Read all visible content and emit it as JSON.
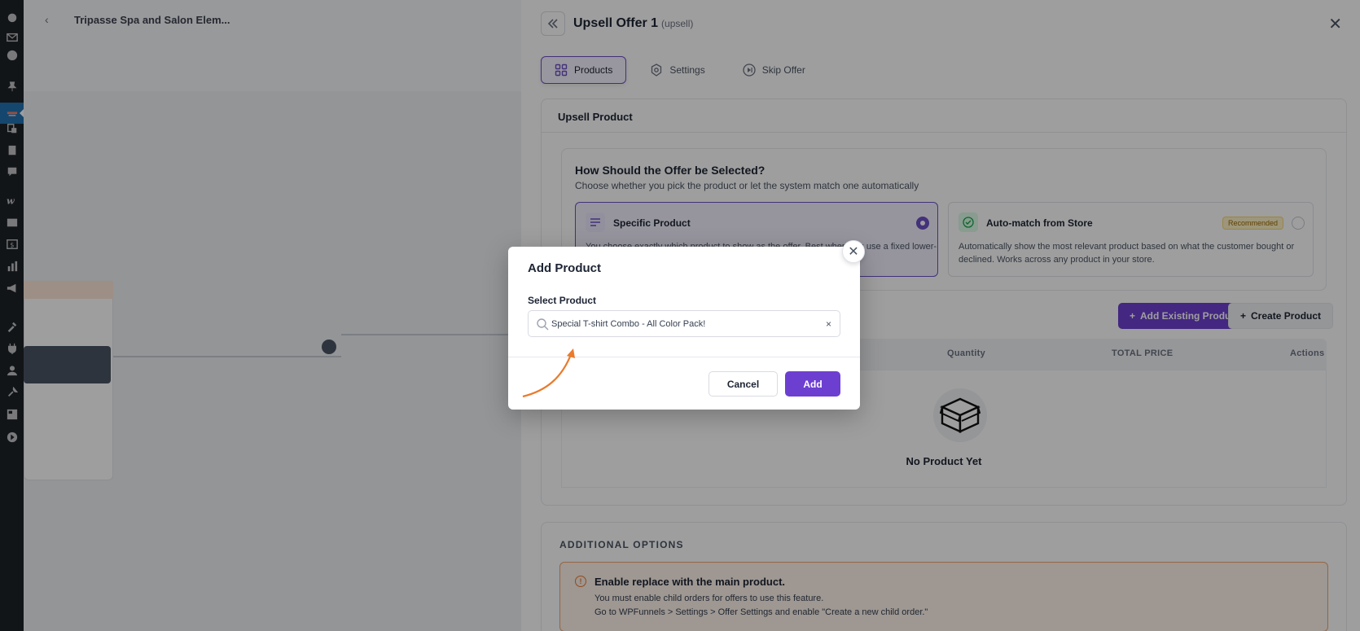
{
  "canvas": {
    "back_label": "‹",
    "funnel_title": "Tripasse Spa and Salon Elem..."
  },
  "panel": {
    "title": "Upsell Offer 1",
    "subtitle": "(upsell)",
    "tabs": [
      {
        "label": "Products",
        "icon": "grid-icon",
        "active": true
      },
      {
        "label": "Settings",
        "icon": "gear-icon",
        "active": false
      },
      {
        "label": "Skip Offer",
        "icon": "skip-icon",
        "active": false
      }
    ],
    "section_title": "Upsell Product",
    "question_title": "How Should the Offer be Selected?",
    "question_desc": "Choose whether you pick the product or let the system match one automatically",
    "options": [
      {
        "title": "Specific Product",
        "desc": "You choose exactly which product to show as the offer. Best when you use a fixed lower-",
        "selected": true
      },
      {
        "title": "Auto-match from Store",
        "badge": "Recommended",
        "desc_line1": "Automatically show the most relevant product based on what the customer bought or",
        "desc_line2": "declined. Works across any product in your store.",
        "selected": false
      }
    ],
    "add_existing_label": "Add Existing Product",
    "create_product_label": "Create Product",
    "table_headers": [
      "Quantity",
      "TOTAL PRICE",
      "Actions"
    ],
    "empty_text": "No Product Yet",
    "additional_title": "ADDITIONAL OPTIONS",
    "warning": {
      "title": "Enable replace with the main product.",
      "line1": "You must enable child orders for offers to use this feature.",
      "line2": "Go to WPFunnels > Settings > Offer Settings and enable \"Create a new child order.\""
    }
  },
  "modal": {
    "title": "Add Product",
    "field_label": "Select Product",
    "selected_product": "Special T-shirt Combo - All Color Pack!",
    "clear_label": "×",
    "cancel_label": "Cancel",
    "add_label": "Add"
  },
  "colors": {
    "accent": "#6d3fd1",
    "warning_border": "#f2a46b",
    "annotation_arrow": "#ea7a2c"
  }
}
